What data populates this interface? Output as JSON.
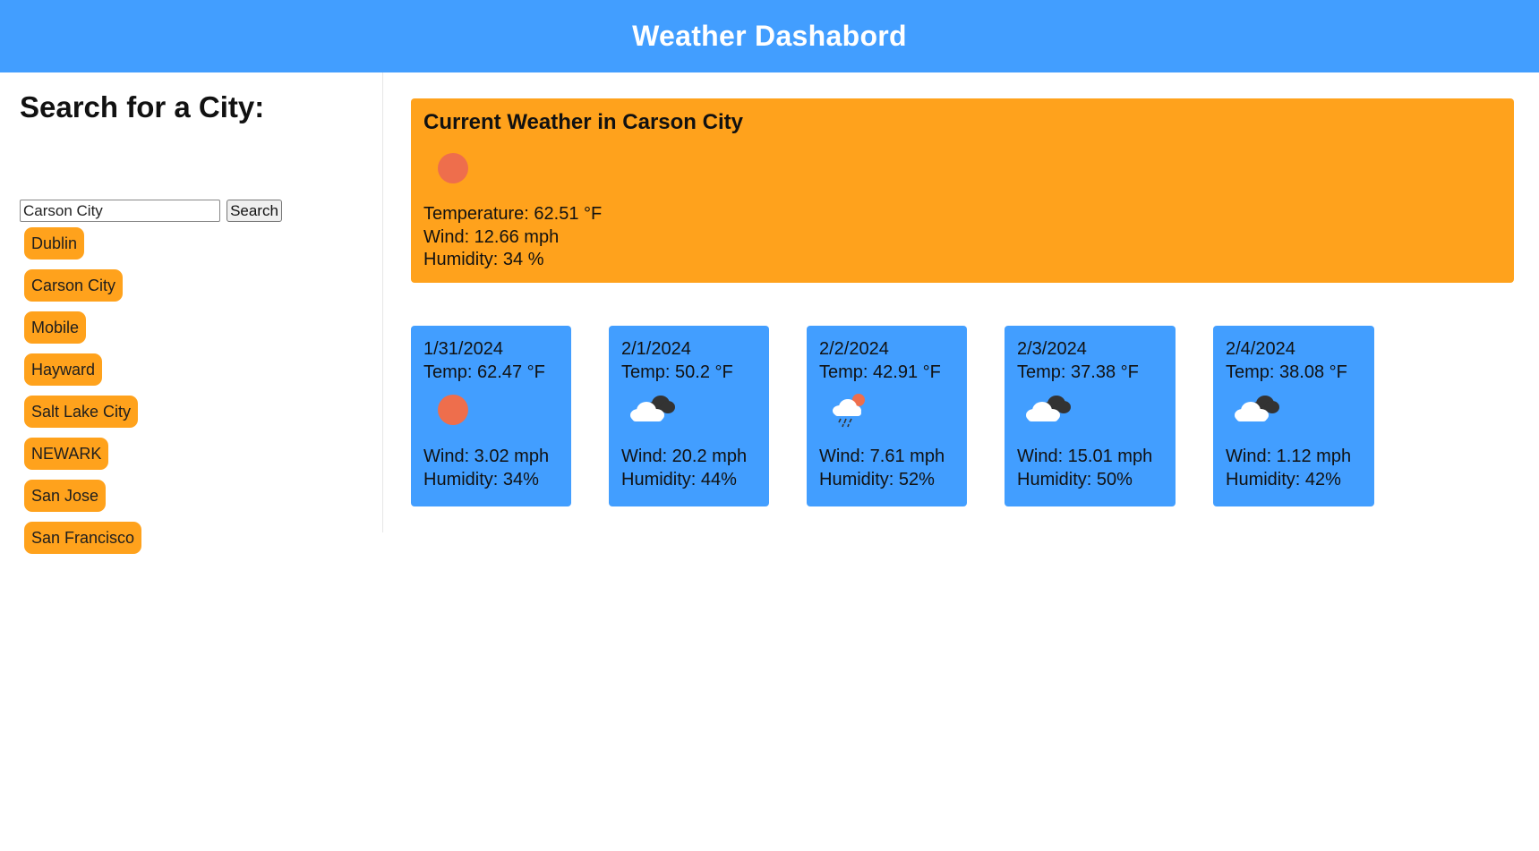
{
  "header": {
    "title": "Weather Dashabord"
  },
  "search": {
    "heading": "Search for a City:",
    "input_value": "Carson City",
    "button_label": "Search"
  },
  "history": [
    "Dublin",
    "Carson City",
    "Mobile",
    "Hayward",
    "Salt Lake City",
    "NEWARK",
    "San Jose",
    "San Francisco"
  ],
  "current": {
    "title": "Current Weather in Carson City",
    "icon": "sun-icon",
    "temperature": "Temperature: 62.51 °F",
    "wind": "Wind: 12.66 mph",
    "humidity": "Humidity: 34 %"
  },
  "forecast": [
    {
      "date": "1/31/2024",
      "temp": "Temp: 62.47 °F",
      "icon": "sun-icon",
      "wind": "Wind: 3.02 mph",
      "humidity": "Humidity: 34%"
    },
    {
      "date": "2/1/2024",
      "temp": "Temp: 50.2 °F",
      "icon": "cloudy-icon",
      "wind": "Wind: 20.2 mph",
      "humidity": "Humidity: 44%"
    },
    {
      "date": "2/2/2024",
      "temp": "Temp: 42.91 °F",
      "icon": "rain-icon",
      "wind": "Wind: 7.61 mph",
      "humidity": "Humidity: 52%"
    },
    {
      "date": "2/3/2024",
      "temp": "Temp: 37.38 °F",
      "icon": "cloudy-icon",
      "wind": "Wind: 15.01 mph",
      "humidity": "Humidity: 50%"
    },
    {
      "date": "2/4/2024",
      "temp": "Temp: 38.08 °F",
      "icon": "cloudy-icon",
      "wind": "Wind: 1.12 mph",
      "humidity": "Humidity: 42%"
    }
  ],
  "colors": {
    "header_bg": "#429eff",
    "accent_orange": "#ffa21c",
    "card_blue": "#429eff",
    "sun": "#ee6e4c"
  }
}
